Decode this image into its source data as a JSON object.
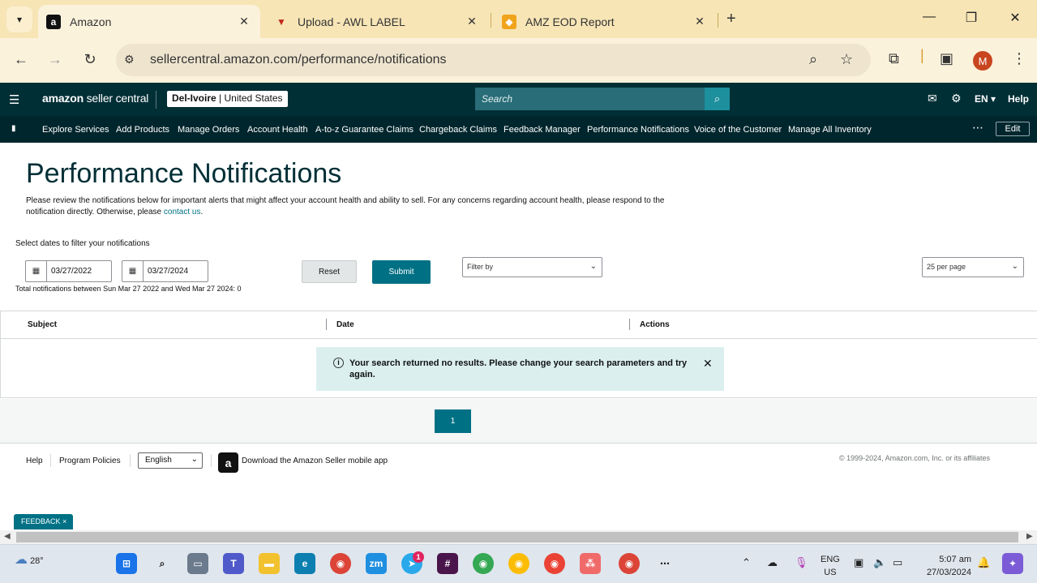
{
  "browser": {
    "tabs": [
      {
        "title": "Amazon",
        "favicon": "amazon-favicon"
      },
      {
        "title": "Upload - AWL LABEL",
        "favicon": "awl-favicon"
      },
      {
        "title": "AMZ EOD Report",
        "favicon": "report-favicon"
      }
    ],
    "url": "sellercentral.amazon.com/performance/notifications",
    "profile_initial": "M"
  },
  "topbar": {
    "logo_bold": "amazon",
    "logo_light": " seller central",
    "store_name": "Del-Ivoire",
    "store_sep": " | ",
    "store_region": "United States",
    "search_placeholder": "Search",
    "language": "EN ▾",
    "help": "Help"
  },
  "nav": {
    "items": [
      "Explore Services",
      "Add Products",
      "Manage Orders",
      "Account Health",
      "A-to-z Guarantee Claims",
      "Chargeback Claims",
      "Feedback Manager",
      "Performance Notifications",
      "Voice of the Customer",
      "Manage All Inventory"
    ],
    "edit": "Edit"
  },
  "page": {
    "title": "Performance Notifications",
    "intro": "Please review the notifications below for important alerts that might affect your account health and ability to sell. For any concerns regarding account health, please respond to the notification directly. Otherwise, please ",
    "intro_link": "contact us",
    "intro_end": ".",
    "filter_label": "Select dates to filter your notifications",
    "start_date": "03/27/2022",
    "end_date": "03/27/2024",
    "reset": "Reset",
    "submit": "Submit",
    "filter_by": "Filter by",
    "per_page": "25 per page",
    "total": "Total notifications between Sun Mar 27 2022 and Wed Mar 27 2024: 0"
  },
  "table": {
    "columns": [
      "Subject",
      "Date",
      "Actions"
    ],
    "alert": "Your search returned no results. Please change your search parameters and try again."
  },
  "pager": {
    "current": "1"
  },
  "footer": {
    "help": "Help",
    "policies": "Program Policies",
    "language": "English",
    "app": "Download the Amazon Seller mobile app",
    "copyright": "© 1999-2024, Amazon.com, Inc. or its affiliates",
    "feedback": "FEEDBACK ×"
  },
  "taskbar": {
    "temperature": "28°",
    "lang_line1": "ENG",
    "lang_line2": "US",
    "time": "5:07 am",
    "date": "27/03/2024",
    "telegram_badge": "1"
  },
  "colors": {
    "seller_central_dark": "#002f36",
    "nav_dark": "#00262d",
    "primary_teal": "#007185",
    "alert_bg": "#dcefef",
    "tab_strip": "#f7e5b6"
  }
}
